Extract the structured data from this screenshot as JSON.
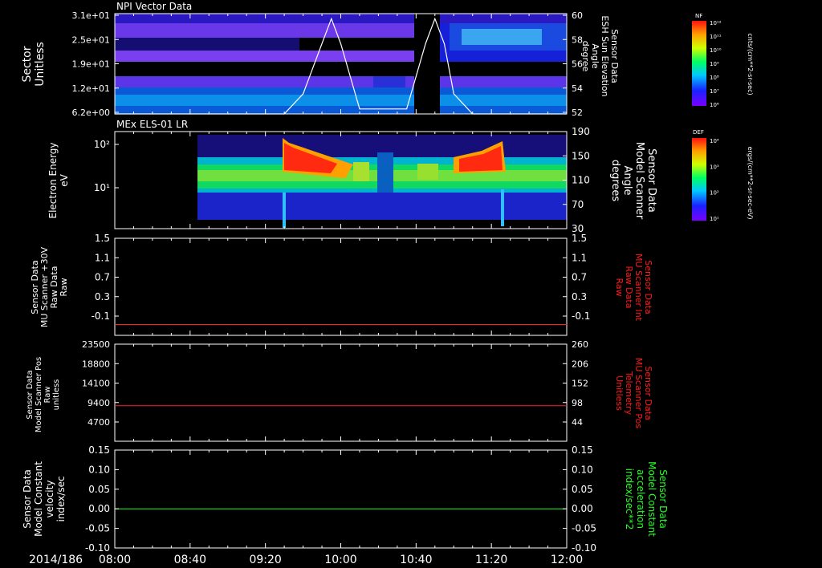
{
  "footer": {
    "date": "2014/186",
    "time_ticks": [
      "08:00",
      "08:40",
      "09:20",
      "10:00",
      "10:40",
      "11:20",
      "12:00"
    ]
  },
  "panels": [
    {
      "id": "npi",
      "title": "NPI Vector Data",
      "left_label": [
        "Sector",
        "Unitless"
      ],
      "right_label": [
        "Sensor Data",
        "ESH Sun Elevation",
        "Angle",
        "degree"
      ],
      "left_ticks": [
        "3.1e+01",
        "2.5e+01",
        "1.9e+01",
        "1.2e+01",
        "6.2e+00"
      ],
      "right_ticks": [
        "60",
        "58",
        "56",
        "54",
        "52"
      ],
      "colorbar": {
        "label": "NF",
        "unit": "cnts/(cm**2-sr-sec)",
        "ticks": [
          "10¹²",
          "10¹¹",
          "10¹⁰",
          "10⁹",
          "10⁸",
          "10⁷",
          "10⁶"
        ]
      }
    },
    {
      "id": "els",
      "title": "MEx ELS-01 LR",
      "left_label": [
        "Electron Energy",
        "eV"
      ],
      "right_label": [
        "Sensor Data",
        "Model Scanner",
        "Angle",
        "degrees"
      ],
      "left_ticks": [
        "10²",
        "10¹"
      ],
      "right_ticks": [
        "190",
        "150",
        "110",
        "70",
        "30"
      ],
      "colorbar": {
        "label": "DEF",
        "unit": "ergs/(cm**2-sr-sec-eV)",
        "ticks": [
          "10⁴",
          "10³",
          "10²",
          "10¹"
        ]
      }
    },
    {
      "id": "mu_int",
      "left_label": [
        "Sensor Data",
        "MU Scanner +30V",
        "Raw Data",
        "Raw"
      ],
      "right_label": [
        "Sensor Data",
        "MU Scanner Int",
        "Raw Data",
        "Raw"
      ],
      "left_ticks": [
        "1.5",
        "1.1",
        "0.7",
        "0.3",
        "-0.1"
      ],
      "right_ticks": [
        "1.5",
        "1.1",
        "0.7",
        "0.3",
        "-0.1"
      ]
    },
    {
      "id": "mu_pos",
      "left_label": [
        "Sensor Data",
        "Model Scanner Pos",
        "Raw",
        "unitless"
      ],
      "right_label": [
        "Sensor Data",
        "MU Scanner Pos",
        "Telemetry",
        "Unitless"
      ],
      "left_ticks": [
        "23500",
        "18800",
        "14100",
        "9400",
        "4700"
      ],
      "right_ticks": [
        "260",
        "206",
        "152",
        "98",
        "44"
      ]
    },
    {
      "id": "const",
      "left_label": [
        "Sensor Data",
        "Model Constant",
        "velocity",
        "index/sec"
      ],
      "right_label": [
        "Sensor Data",
        "Model Constant",
        "acceleration",
        "index/sec**2"
      ],
      "left_ticks": [
        "0.15",
        "0.10",
        "0.05",
        "0.00",
        "-0.05",
        "-0.10"
      ],
      "right_ticks": [
        "0.15",
        "0.10",
        "0.05",
        "0.00",
        "-0.05",
        "-0.10"
      ]
    }
  ],
  "colors": {
    "background": "#000000",
    "axis": "#ffffff",
    "red_trace": "#ff2020",
    "green_trace": "#20ff20",
    "red_label": "#ff1a1a",
    "green_label": "#22ff22"
  },
  "chart_data": [
    {
      "type": "heatmap",
      "panel": "npi",
      "x_unit": "time",
      "xlim": [
        "08:00",
        "12:00"
      ],
      "y_sectors_unitless_ylim": [
        0,
        31
      ],
      "overlay_series": {
        "axis": "right",
        "ylim": [
          50,
          60
        ],
        "x": [
          "08:00",
          "09:30",
          "09:40",
          "09:50",
          "09:55",
          "10:00",
          "10:10",
          "10:35",
          "10:45",
          "10:50",
          "10:55",
          "11:00",
          "11:10",
          "12:00"
        ],
        "values": [
          50,
          50,
          52,
          57,
          59.5,
          57,
          50.5,
          50.5,
          57,
          59.5,
          57,
          52,
          50,
          50
        ]
      }
    },
    {
      "type": "heatmap",
      "panel": "els",
      "x_unit": "time",
      "xlim": [
        "08:00",
        "12:00"
      ],
      "y_log_scale": true,
      "overlay_series": {
        "axis": "right",
        "ylim": [
          10,
          190
        ],
        "x": [
          "08:00",
          "12:00"
        ],
        "values": [
          10,
          10
        ]
      }
    },
    {
      "type": "line",
      "panel": "mu_int",
      "x": [
        "08:00",
        "12:00"
      ],
      "series": [
        {
          "values": [
            -0.1,
            -0.1
          ]
        }
      ],
      "ylim": [
        -0.3,
        1.5
      ]
    },
    {
      "type": "line",
      "panel": "mu_pos",
      "x": [
        "08:00",
        "12:00"
      ],
      "series": [
        {
          "values": [
            8600,
            8600
          ]
        }
      ],
      "ylim": [
        0,
        23500
      ]
    },
    {
      "type": "line",
      "panel": "const",
      "x": [
        "08:00",
        "12:00"
      ],
      "series": [
        {
          "values": [
            0.0,
            0.0
          ]
        }
      ],
      "ylim": [
        -0.1,
        0.15
      ]
    }
  ]
}
